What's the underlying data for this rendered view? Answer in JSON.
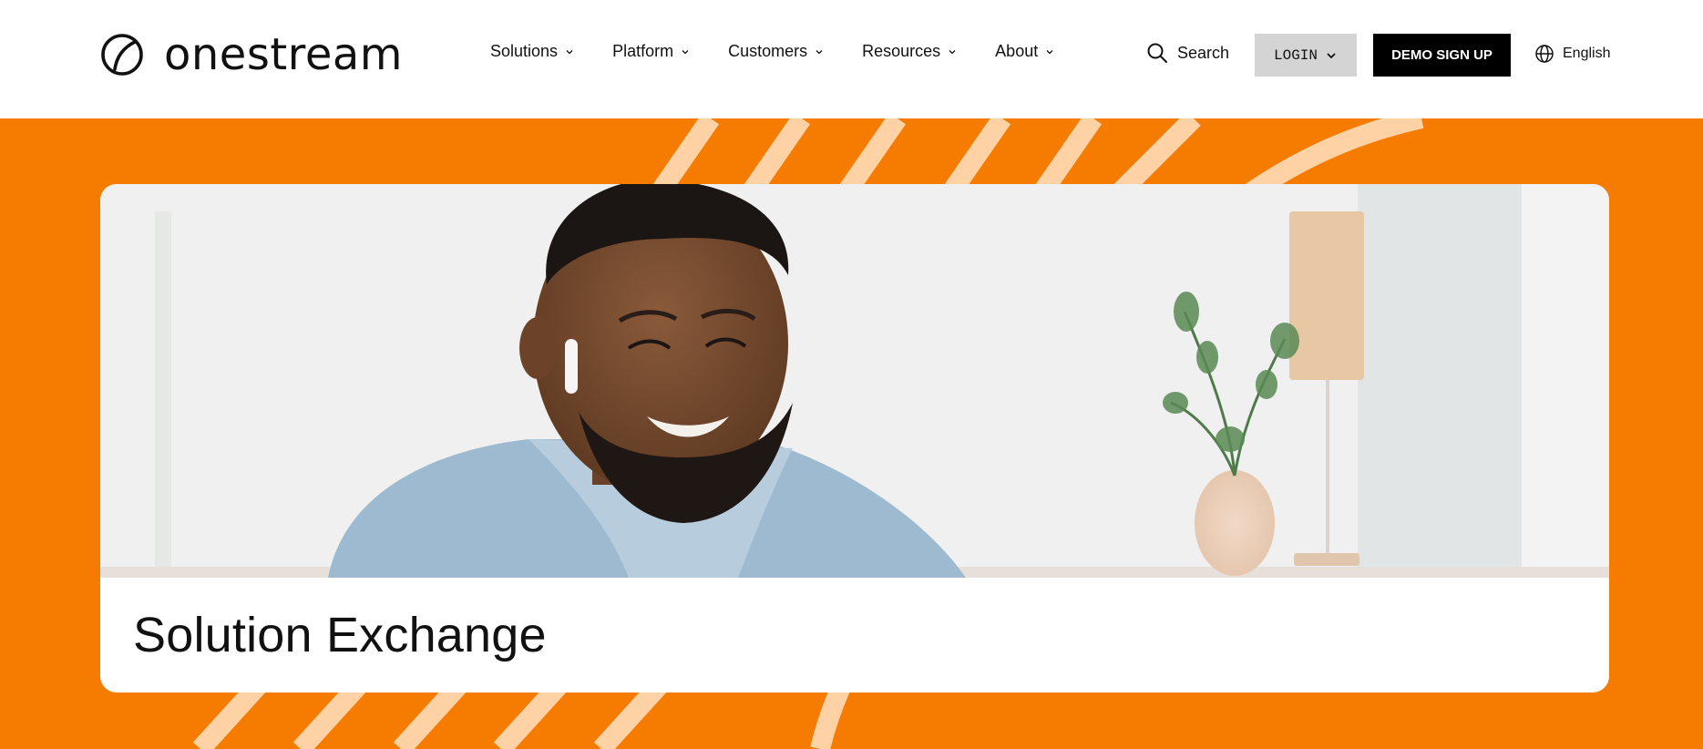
{
  "brand": {
    "name": "onestream",
    "icon": "onestream-logo-icon"
  },
  "nav": {
    "items": [
      {
        "label": "Solutions"
      },
      {
        "label": "Platform"
      },
      {
        "label": "Customers"
      },
      {
        "label": "Resources"
      },
      {
        "label": "About"
      }
    ]
  },
  "header": {
    "search_label": "Search",
    "login_label": "LOGIN",
    "demo_label": "DEMO SIGN UP",
    "language_label": "English"
  },
  "hero": {
    "title": "Solution Exchange",
    "image": "smiling-man-with-earbud-photo"
  },
  "colors": {
    "accent": "#f57c00",
    "stripe": "#ffd2a6",
    "login_bg": "#d4d4d4",
    "demo_bg": "#000000"
  }
}
